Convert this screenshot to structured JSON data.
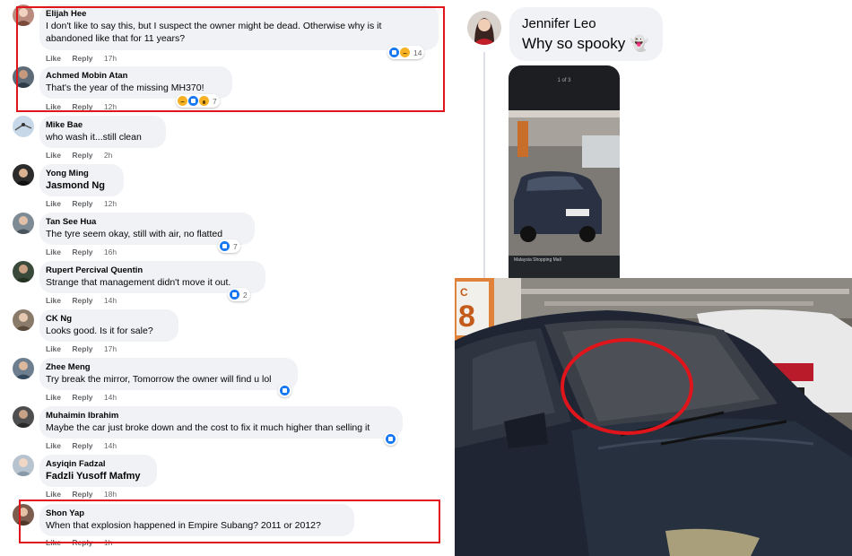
{
  "comments": [
    {
      "author": "Elijah Hee",
      "text": "I don't like to say this, but I suspect the owner might be dead. Otherwise why is it abandoned like that for 11 years?",
      "like": "Like",
      "reply": "Reply",
      "time": "17h",
      "reactions": [
        "like",
        "sad"
      ],
      "reaction_count": "14"
    },
    {
      "author": "Achmed Mobin Atan",
      "text": "That's the year of the missing MH370!",
      "like": "Like",
      "reply": "Reply",
      "time": "12h",
      "reactions": [
        "sad",
        "like",
        "wow"
      ],
      "reaction_count": "7"
    },
    {
      "author": "Mike Bae",
      "text": "who wash it...still clean",
      "like": "Like",
      "reply": "Reply",
      "time": "2h"
    },
    {
      "author": "Yong Ming",
      "text": "Jasmond Ng",
      "like": "Like",
      "reply": "Reply",
      "time": "12h"
    },
    {
      "author": "Tan See Hua",
      "text": "The tyre seem okay, still with air, no flatted",
      "like": "Like",
      "reply": "Reply",
      "time": "16h",
      "reactions": [
        "like"
      ],
      "reaction_count": "7"
    },
    {
      "author": "Rupert Percival Quentin",
      "text": "Strange that management didn't move it out.",
      "like": "Like",
      "reply": "Reply",
      "time": "14h",
      "reactions": [
        "like"
      ],
      "reaction_count": "2"
    },
    {
      "author": "CK Ng",
      "text": "Looks good. Is it for sale?",
      "like": "Like",
      "reply": "Reply",
      "time": "17h"
    },
    {
      "author": "Zhee Meng",
      "text": "Try break the mirror, Tomorrow the owner will find u lol",
      "like": "Like",
      "reply": "Reply",
      "time": "14h",
      "reactions": [
        "like"
      ]
    },
    {
      "author": "Muhaimin Ibrahim",
      "text": "Maybe the car just broke down and the cost to fix it much higher than selling it",
      "like": "Like",
      "reply": "Reply",
      "time": "14h",
      "reactions": [
        "like"
      ]
    },
    {
      "author": "Asyiqin Fadzal",
      "text": "Fadzli Yusoff Mafmy",
      "like": "Like",
      "reply": "Reply",
      "time": "18h"
    },
    {
      "author": "Shon Yap",
      "text": "When that explosion happened in Empire Subang? 2011 or 2012?",
      "like": "Like",
      "reply": "Reply",
      "time": "1h"
    }
  ],
  "post": {
    "author": "Jennifer Leo",
    "text": "Why so spooky 👻",
    "thumb_counter": "1 of 3",
    "thumb_caption": "Malaysia Shopping Mall"
  },
  "photo": {
    "pillar_label": "C 8"
  },
  "colors": {
    "highlight": "#e0151b",
    "bubble": "#f0f2f5",
    "meta": "#65676b",
    "like": "#1877f2",
    "emoji": "#f7b125"
  }
}
